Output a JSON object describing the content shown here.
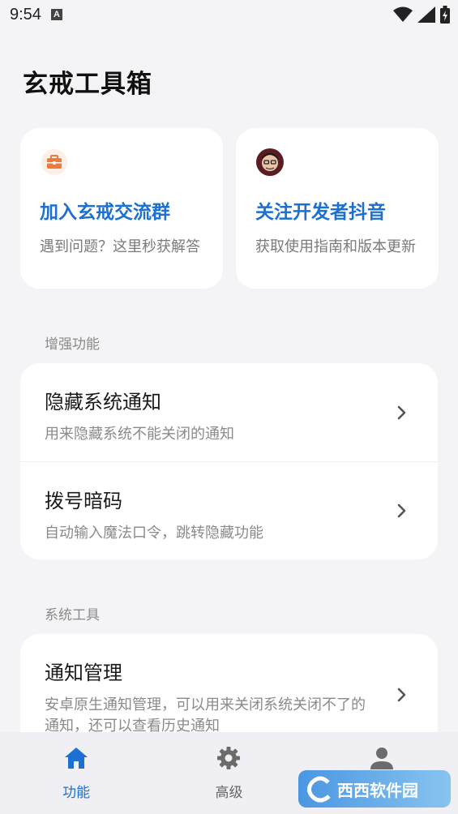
{
  "status": {
    "time": "9:54",
    "badge": "A"
  },
  "page": {
    "title": "玄戒工具箱"
  },
  "promo": [
    {
      "title": "加入玄戒交流群",
      "desc": "遇到问题？这里秒获解答",
      "icon": "toolbox-icon"
    },
    {
      "title": "关注开发者抖音",
      "desc": "获取使用指南和版本更新",
      "icon": "avatar-icon"
    }
  ],
  "sections": [
    {
      "label": "增强功能",
      "items": [
        {
          "title": "隐藏系统通知",
          "desc": "用来隐藏系统不能关闭的通知"
        },
        {
          "title": "拨号暗码",
          "desc": "自动输入魔法口令，跳转隐藏功能"
        }
      ]
    },
    {
      "label": "系统工具",
      "items": [
        {
          "title": "通知管理",
          "desc": "安卓原生通知管理，可以用来关闭系统关闭不了的通知，还可以查看历史通知"
        }
      ]
    }
  ],
  "nav": [
    {
      "label": "功能",
      "icon": "home-icon",
      "active": true
    },
    {
      "label": "高级",
      "icon": "gear-icon",
      "active": false
    },
    {
      "label": "",
      "icon": "person-icon",
      "active": false
    }
  ],
  "watermark": {
    "text": "西西软件园"
  },
  "colors": {
    "accent": "#1c6fd3",
    "background": "#f4f4f6",
    "card": "#ffffff"
  }
}
